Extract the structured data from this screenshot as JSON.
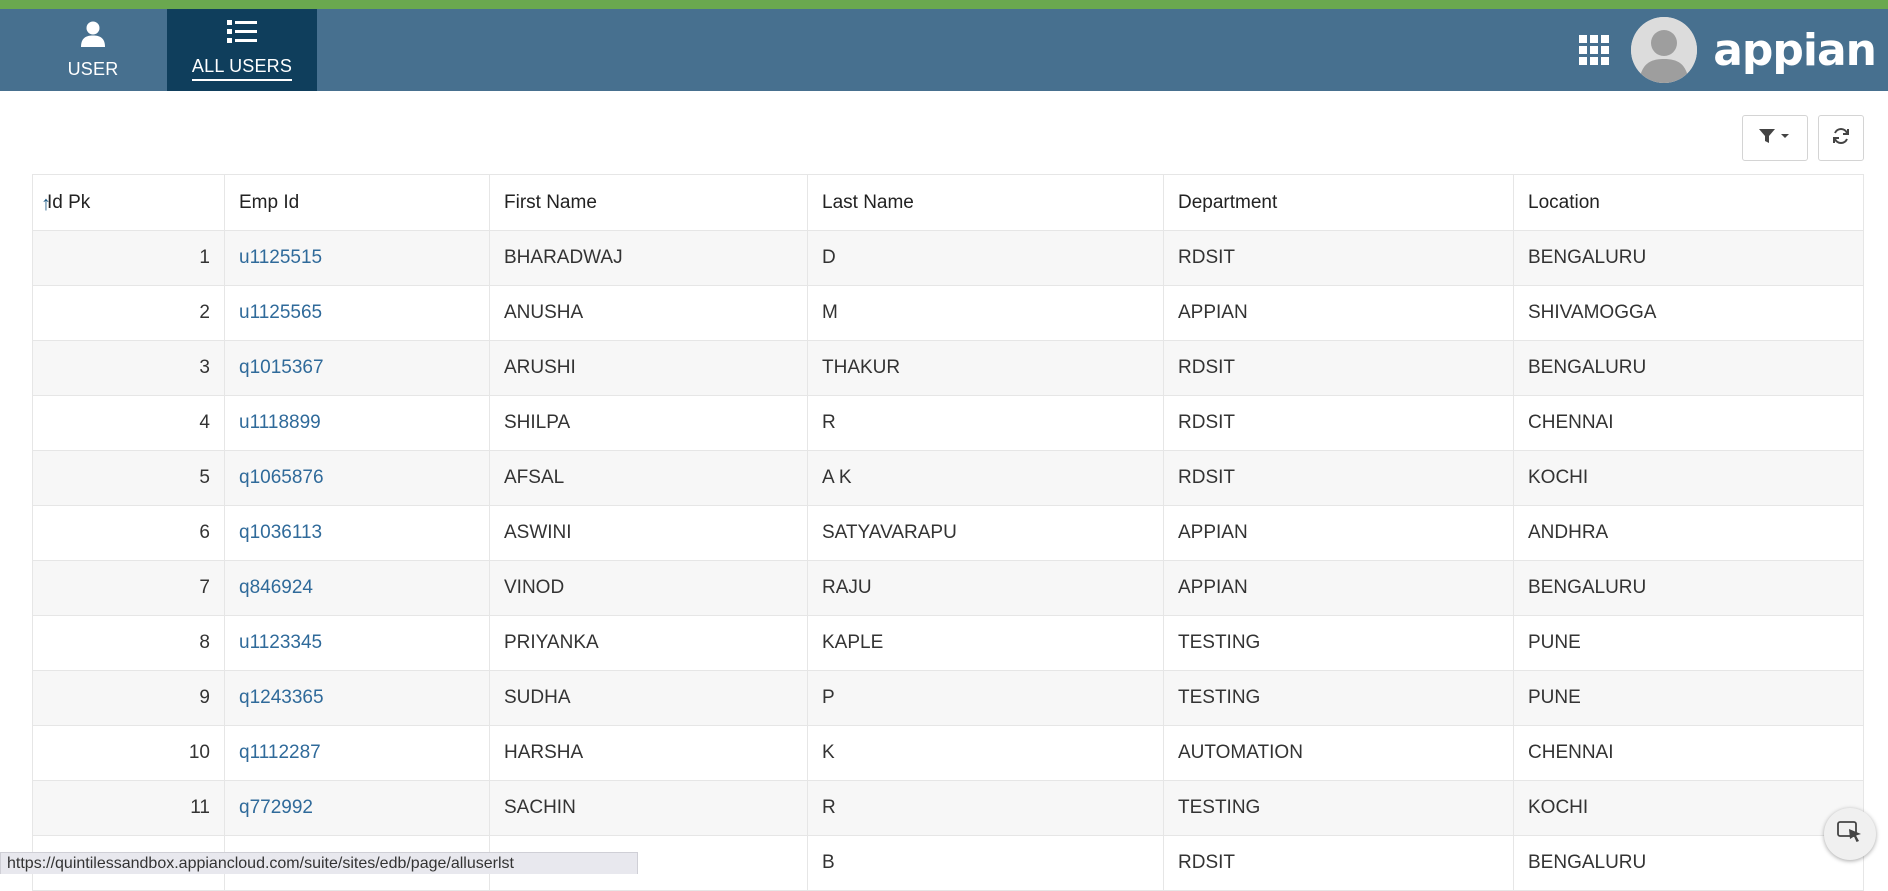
{
  "nav": {
    "tabs": [
      {
        "label": "USER",
        "icon": "user-icon"
      },
      {
        "label": "ALL USERS",
        "icon": "list-icon"
      }
    ],
    "apps_icon": "grid-icon",
    "logo_text": "appian",
    "colors": {
      "navbar": "#47708f",
      "active_tab": "#0f3e5c",
      "top_stripe": "#6aa84f"
    }
  },
  "toolbar": {
    "filter_icon": "filter-icon",
    "refresh_icon": "refresh-icon"
  },
  "table": {
    "sort_icon": "sort-ascending-icon",
    "headers": [
      "Id Pk",
      "Emp Id",
      "First Name",
      "Last Name",
      "Department",
      "Location"
    ],
    "rows": [
      {
        "id": "1",
        "emp": "u1125515",
        "first": "BHARADWAJ",
        "last": "D",
        "dept": "RDSIT",
        "loc": "BENGALURU"
      },
      {
        "id": "2",
        "emp": "u1125565",
        "first": "ANUSHA",
        "last": "M",
        "dept": "APPIAN",
        "loc": "SHIVAMOGGA"
      },
      {
        "id": "3",
        "emp": "q1015367",
        "first": "ARUSHI",
        "last": "THAKUR",
        "dept": "RDSIT",
        "loc": "BENGALURU"
      },
      {
        "id": "4",
        "emp": "u1118899",
        "first": "SHILPA",
        "last": "R",
        "dept": "RDSIT",
        "loc": "CHENNAI"
      },
      {
        "id": "5",
        "emp": "q1065876",
        "first": "AFSAL",
        "last": "A K",
        "dept": "RDSIT",
        "loc": "KOCHI"
      },
      {
        "id": "6",
        "emp": "q1036113",
        "first": "ASWINI",
        "last": "SATYAVARAPU",
        "dept": "APPIAN",
        "loc": "ANDHRA"
      },
      {
        "id": "7",
        "emp": "q846924",
        "first": "VINOD",
        "last": "RAJU",
        "dept": "APPIAN",
        "loc": "BENGALURU"
      },
      {
        "id": "8",
        "emp": "u1123345",
        "first": "PRIYANKA",
        "last": "KAPLE",
        "dept": "TESTING",
        "loc": "PUNE"
      },
      {
        "id": "9",
        "emp": "q1243365",
        "first": "SUDHA",
        "last": "P",
        "dept": "TESTING",
        "loc": "PUNE"
      },
      {
        "id": "10",
        "emp": "q1112287",
        "first": "HARSHA",
        "last": "K",
        "dept": "AUTOMATION",
        "loc": "CHENNAI"
      },
      {
        "id": "11",
        "emp": "q772992",
        "first": "SACHIN",
        "last": "R",
        "dept": "TESTING",
        "loc": "KOCHI"
      },
      {
        "id": "",
        "emp": "",
        "first": "",
        "last": "B",
        "dept": "RDSIT",
        "loc": "BENGALURU"
      }
    ]
  },
  "status_url": "https://quintilessandbox.appiancloud.com/suite/sites/edb/page/alluserlst",
  "float_button_icon": "cursor-select-icon"
}
